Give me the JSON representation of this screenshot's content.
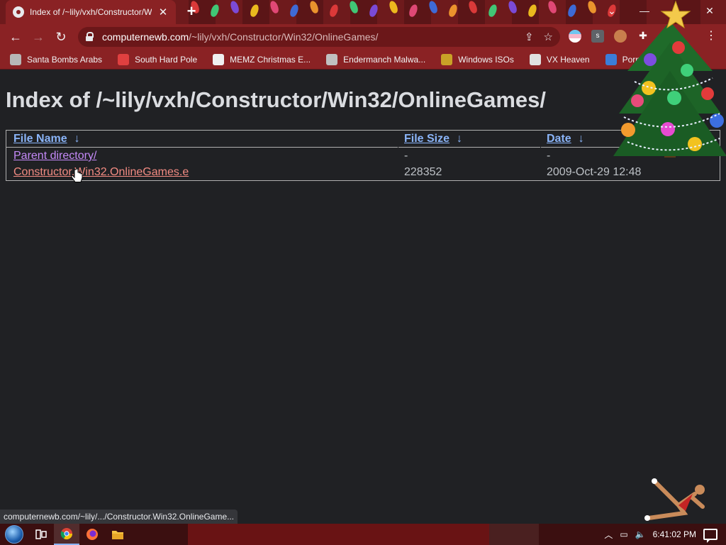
{
  "browser": {
    "tab_title": "Index of /~lily/vxh/Constructor/W",
    "url_host": "computernewb.com",
    "url_path": "/~lily/vxh/Constructor/Win32/OnlineGames/"
  },
  "bookmarks": [
    {
      "label": "Santa Bombs Arabs",
      "icon": "santa-icon",
      "color": "#b7b7b7"
    },
    {
      "label": "South Hard Pole",
      "icon": "snowflake-icon",
      "color": "#e04040"
    },
    {
      "label": "MEMZ Christmas E...",
      "icon": "memz-icon",
      "color": "#f0f0f0"
    },
    {
      "label": "Endermanch Malwa...",
      "icon": "endermanch-icon",
      "color": "#c0c0c0"
    },
    {
      "label": "Windows ISOs",
      "icon": "windows-isos-icon",
      "color": "#c9a227"
    },
    {
      "label": "VX Heaven",
      "icon": "vx-heaven-icon",
      "color": "#e0e0e0"
    },
    {
      "label": "Pornography AF",
      "icon": "person-icon",
      "color": "#3b7dd8"
    }
  ],
  "page": {
    "heading": "Index of /~lily/vxh/Constructor/Win32/OnlineGames/",
    "columns": {
      "name": "File Name",
      "size": "File Size",
      "date": "Date",
      "sort_arrow": "↓"
    },
    "rows": [
      {
        "name": "Parent directory/",
        "size": "-",
        "date": "-"
      },
      {
        "name": "Constructor.Win32.OnlineGames.e",
        "size": "228352",
        "date": "2009-Oct-29 12:48"
      }
    ]
  },
  "status_bar": "computernewb.com/~lily/.../Constructor.Win32.OnlineGame...",
  "taskbar": {
    "clock": "6:41:02 PM",
    "icons": [
      "start-orb-icon",
      "task-view-icon",
      "chrome-icon",
      "firefox-icon",
      "file-explorer-icon"
    ]
  },
  "colors": {
    "accent": "#8a2224",
    "link": "#8ab4f8",
    "visited": "#c58af9",
    "hover_link": "#f28b82"
  }
}
